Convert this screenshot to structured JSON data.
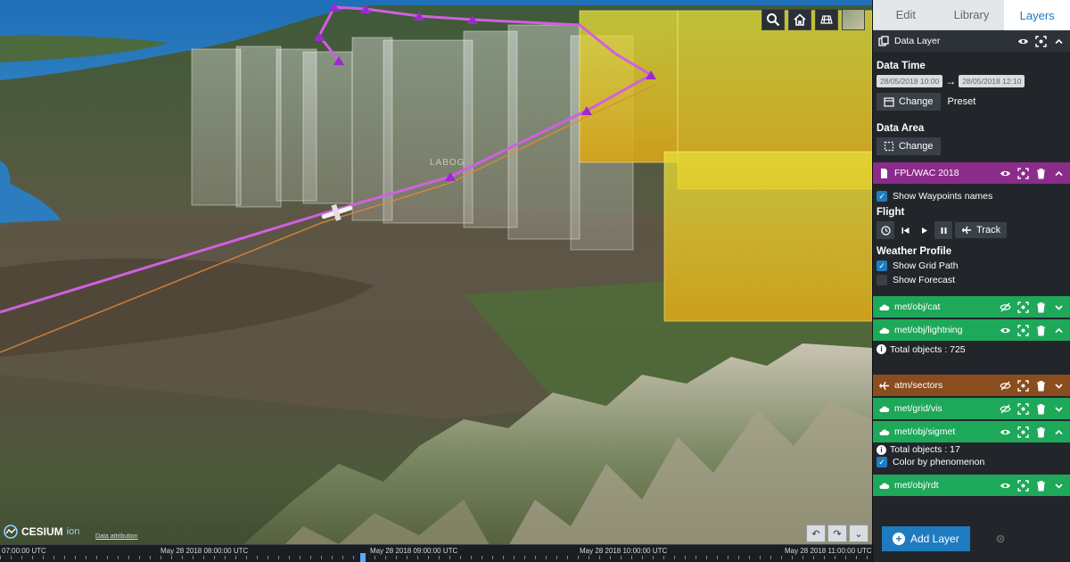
{
  "map": {
    "waypoint_label": "LABOG",
    "attribution": "Data attribution",
    "logo_text": "CESIUM",
    "logo_suffix": "ion",
    "toolbar_icons": [
      "search-icon",
      "home-icon",
      "grid-mode-icon",
      "basemap-picker-icon"
    ]
  },
  "timeline": {
    "ticks": [
      "07:00:00 UTC",
      "May 28 2018 08:00:00 UTC",
      "May 28 2018 09:00:00 UTC",
      "May 28 2018 10:00:00 UTC",
      "May 28 2018 11:00:00 UTC"
    ]
  },
  "panel": {
    "tabs": [
      {
        "label": "Edit",
        "active": false
      },
      {
        "label": "Library",
        "active": false
      },
      {
        "label": "Layers",
        "active": true
      }
    ],
    "data_layer": {
      "name": "Data Layer",
      "data_time_title": "Data Time",
      "time_from": "28/05/2018 10:00",
      "time_to": "28/05/2018 12:10",
      "change_label": "Change",
      "preset_label": "Preset",
      "data_area_title": "Data Area",
      "area_change_label": "Change"
    },
    "fpl_layer": {
      "name": "FPL/WAC 2018",
      "show_waypoints_label": "Show Waypoints names",
      "show_waypoints": true,
      "flight_title": "Flight",
      "track_label": "Track",
      "weather_title": "Weather Profile",
      "show_grid_path_label": "Show Grid Path",
      "show_grid_path": true,
      "show_forecast_label": "Show Forecast",
      "show_forecast": false
    },
    "layers": [
      {
        "name": "met/obj/cat",
        "color": "#1ea85a"
      },
      {
        "name": "met/obj/lightning",
        "color": "#1ea85a",
        "info": "Total objects : 725"
      },
      {
        "name": "atm/sectors",
        "color": "#8a4d1e"
      },
      {
        "name": "met/grid/vis",
        "color": "#1ea85a"
      },
      {
        "name": "met/obj/sigmet",
        "color": "#1ea85a",
        "info": "Total objects : 17",
        "option_label": "Color by phenomenon"
      },
      {
        "name": "met/obj/rdt",
        "color": "#1ea85a"
      }
    ],
    "add_layer_label": "Add Layer"
  },
  "colors": {
    "accent": "#1f7bc0",
    "flight_path": "#d060e0",
    "fpl_header": "#8c2c8a",
    "met_header": "#1ea85a",
    "atm_header": "#8a4d1e"
  }
}
